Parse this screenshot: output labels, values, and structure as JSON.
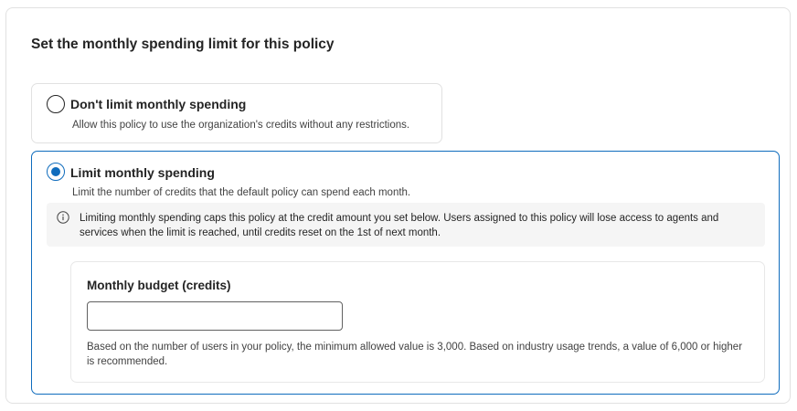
{
  "section": {
    "title": "Set the monthly spending limit for this policy"
  },
  "options": {
    "unlimited": {
      "label": "Don't limit monthly spending",
      "description": "Allow this policy to use the organization's credits without any restrictions.",
      "selected": false
    },
    "limited": {
      "label": "Limit monthly spending",
      "description": "Limit the number of credits that the default policy can spend each month.",
      "selected": true
    }
  },
  "info": {
    "icon": "info-icon",
    "text": "Limiting monthly spending caps this policy at the credit amount you set below. Users assigned to this policy will lose access to agents and services when the limit is reached, until credits reset on the 1st of next month."
  },
  "budget": {
    "label": "Monthly budget (credits)",
    "value": "",
    "hint": "Based on the number of users in your policy, the minimum allowed value is 3,000. Based on industry usage trends, a value of 6,000 or higher is recommended."
  },
  "colors": {
    "accent": "#0f6cbd",
    "border": "#e1e1e1",
    "info_background": "#f5f5f5",
    "text": "#242424"
  }
}
